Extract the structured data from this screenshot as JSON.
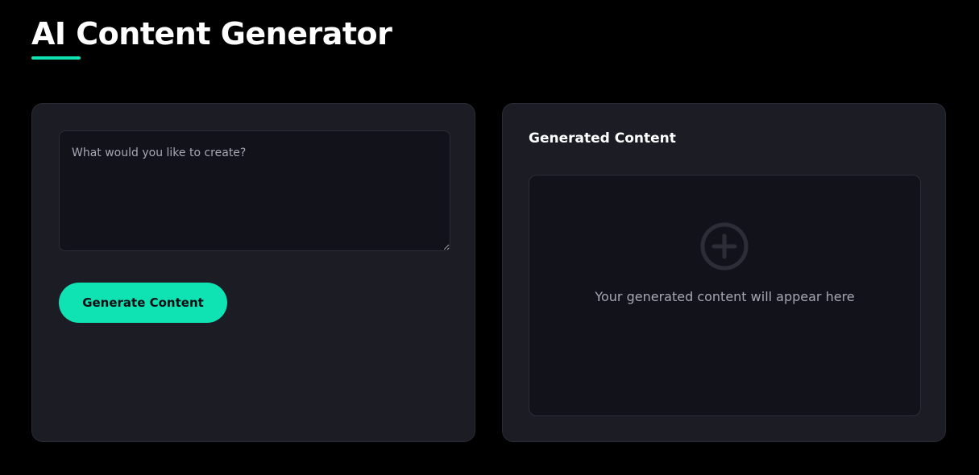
{
  "header": {
    "title": "AI Content Generator"
  },
  "input_panel": {
    "prompt_placeholder": "What would you like to create?",
    "prompt_value": "",
    "generate_label": "Generate Content"
  },
  "output_panel": {
    "title": "Generated Content",
    "empty_icon": "plus-circle-icon",
    "empty_message": "Your generated content will appear here"
  },
  "colors": {
    "background": "#000000",
    "panel": "#1b1c24",
    "field": "#12131a",
    "accent": "#10e3b3",
    "muted_text": "#a6a7b4"
  }
}
